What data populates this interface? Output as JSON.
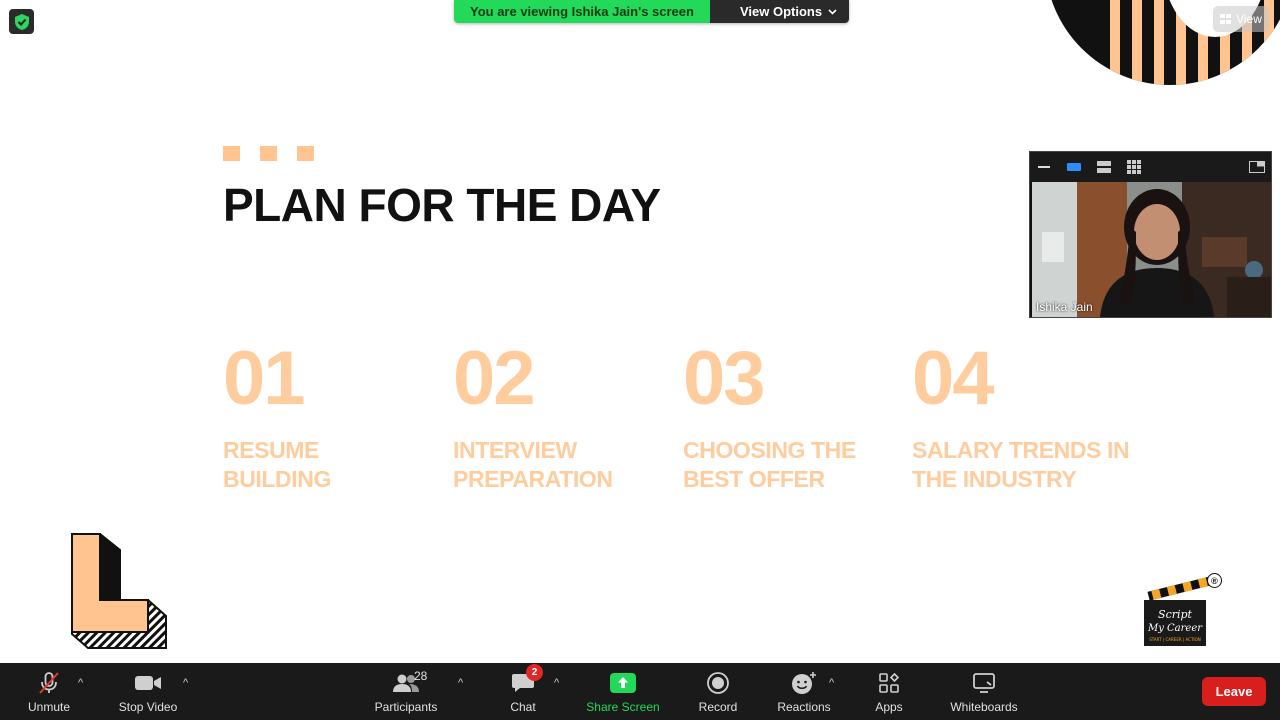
{
  "app": {
    "viewing_banner": "You are viewing Ishika Jain's screen",
    "view_options_label": "View Options",
    "view_button_label": "View"
  },
  "slide": {
    "title": "PLAN FOR THE DAY",
    "items": [
      {
        "number": "01",
        "text": "RESUME BUILDING"
      },
      {
        "number": "02",
        "text": "INTERVIEW PREPARATION"
      },
      {
        "number": "03",
        "text": "CHOOSING THE BEST OFFER"
      },
      {
        "number": "04",
        "text": "SALARY TRENDS IN THE INDUSTRY"
      }
    ],
    "logo_text_1": "Script",
    "logo_text_2": "My Career",
    "logo_tagline": "START | CAREER | ACTION",
    "registered_mark": "®",
    "colors": {
      "accent": "#ffcc9e",
      "title": "#111111"
    }
  },
  "video": {
    "participant_name": "Ishika Jain"
  },
  "toolbar": {
    "unmute_label": "Unmute",
    "stop_video_label": "Stop Video",
    "participants_label": "Participants",
    "participants_count": "28",
    "chat_label": "Chat",
    "chat_badge": "2",
    "share_screen_label": "Share Screen",
    "record_label": "Record",
    "reactions_label": "Reactions",
    "apps_label": "Apps",
    "whiteboards_label": "Whiteboards",
    "leave_label": "Leave",
    "colors": {
      "share_green": "#23d959",
      "leave_red": "#d91e1e",
      "badge_red": "#e02828"
    }
  }
}
